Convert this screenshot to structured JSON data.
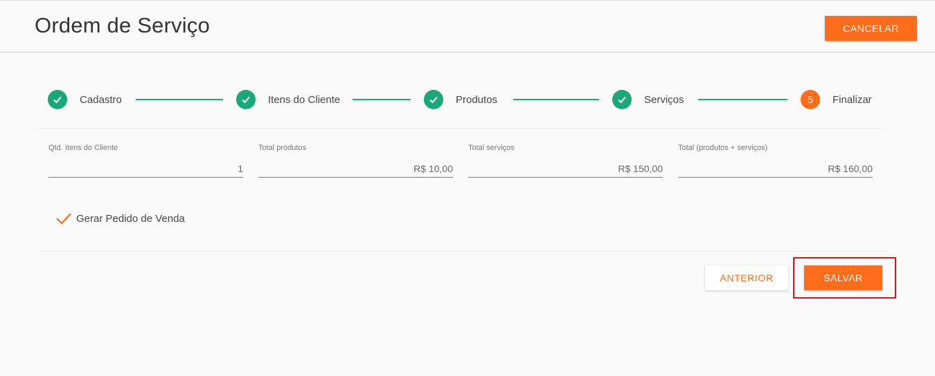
{
  "header": {
    "title": "Ordem de Serviço",
    "cancel_label": "CANCELAR"
  },
  "stepper": {
    "steps": [
      {
        "label": "Cadastro",
        "status": "done",
        "icon": "check-icon"
      },
      {
        "label": "Itens do Cliente",
        "status": "done",
        "icon": "check-icon"
      },
      {
        "label": "Produtos",
        "status": "done",
        "icon": "check-icon"
      },
      {
        "label": "Serviços",
        "status": "done",
        "icon": "check-icon"
      },
      {
        "label": "Finalizar",
        "status": "active",
        "number": "5"
      }
    ]
  },
  "summary": {
    "fields": [
      {
        "label": "Qtd. Itens do Cliente",
        "value": "1"
      },
      {
        "label": "Total produtos",
        "value": "R$ 10,00"
      },
      {
        "label": "Total serviços",
        "value": "R$ 150,00"
      },
      {
        "label": "Total (produtos + serviços)",
        "value": "R$ 160,00"
      }
    ]
  },
  "options": {
    "generate_sales_order_label": "Gerar Pedido de Venda",
    "generate_sales_order_checked": true
  },
  "footer": {
    "previous_label": "ANTERIOR",
    "save_label": "SALVAR"
  },
  "colors": {
    "accent": "#ff6d1a",
    "success": "#1aa879",
    "highlight": "#e0101e",
    "background": "#fafafa"
  }
}
